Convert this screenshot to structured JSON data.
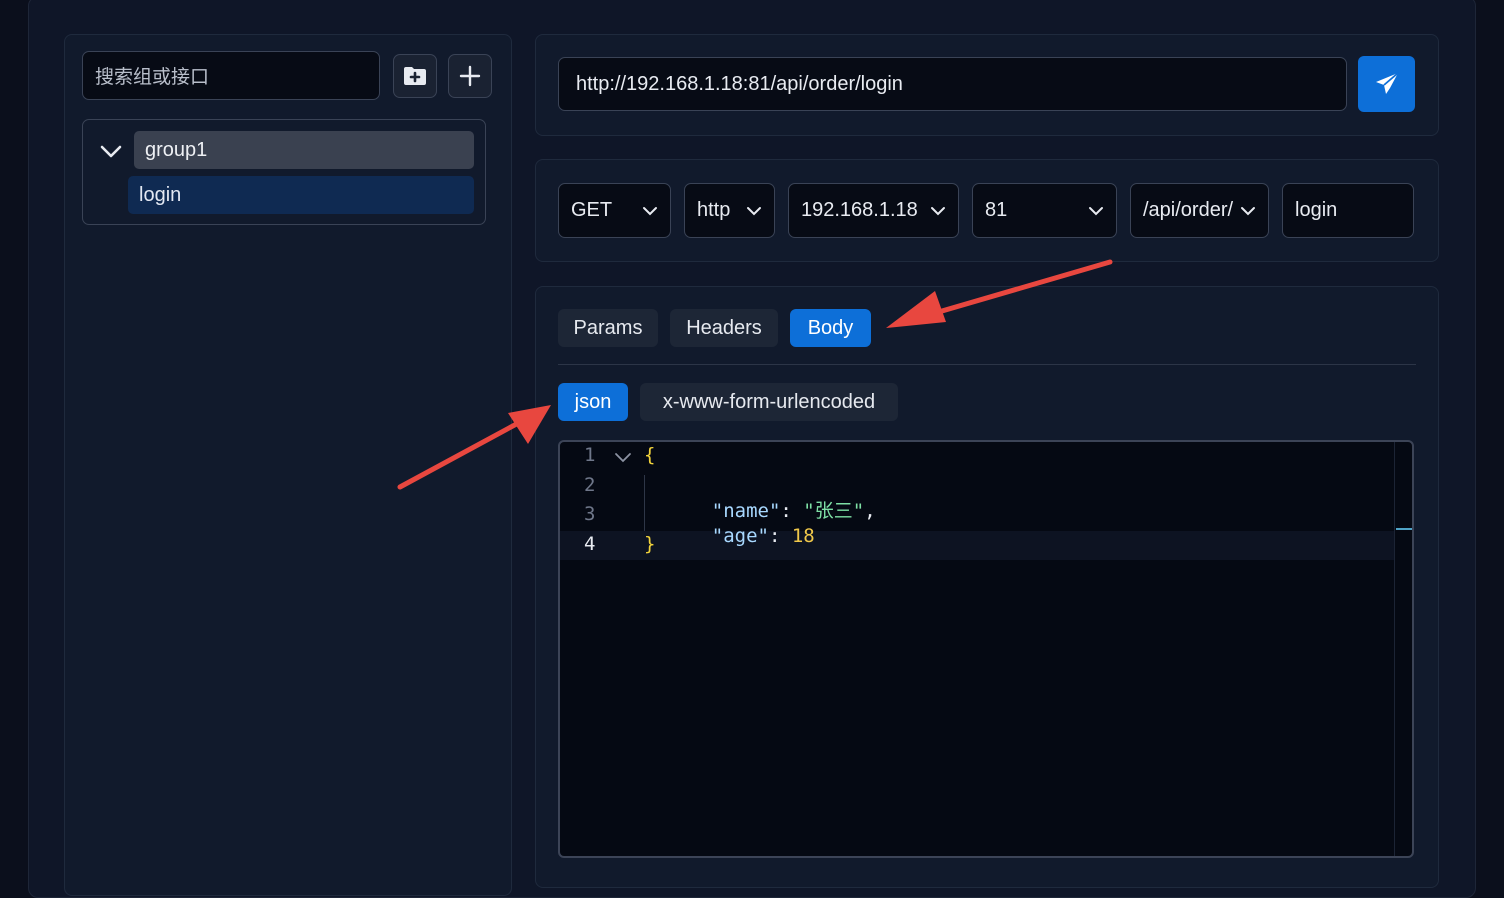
{
  "sidebar": {
    "search_placeholder": "搜索组或接口",
    "add_folder_icon": "folder-plus-icon",
    "add_icon": "plus-icon",
    "tree": {
      "group_label": "group1",
      "items": [
        {
          "label": "login"
        }
      ]
    }
  },
  "url_bar": {
    "url": "http://192.168.1.18:81/api/order/login",
    "send_icon": "paper-plane-icon"
  },
  "request_parts": {
    "method": "GET",
    "protocol": "http",
    "host": "192.168.1.18",
    "port": "81",
    "path": "/api/order/",
    "endpoint": "login"
  },
  "tabs": [
    {
      "label": "Params",
      "active": false
    },
    {
      "label": "Headers",
      "active": false
    },
    {
      "label": "Body",
      "active": true
    }
  ],
  "body_types": [
    {
      "label": "json",
      "active": true
    },
    {
      "label": "x-www-form-urlencoded",
      "active": false
    }
  ],
  "editor": {
    "lines": [
      {
        "number": "1",
        "text": "{"
      },
      {
        "number": "2",
        "key": "\"name\"",
        "value": "\"张三\""
      },
      {
        "number": "3",
        "key": "\"age\"",
        "value": "18"
      },
      {
        "number": "4",
        "text": "}"
      }
    ]
  },
  "colors": {
    "accent": "#0d6fd8",
    "annotation_arrow": "#e8473f",
    "json_key": "#a8d8ff",
    "json_string": "#7ee0a5",
    "json_number": "#f0c84a",
    "json_brace": "#f2d33b"
  }
}
